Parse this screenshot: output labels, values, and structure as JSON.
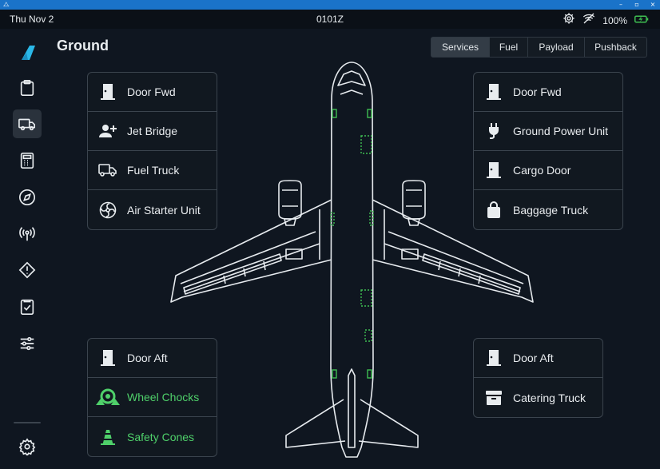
{
  "statusbar": {
    "date": "Thu Nov 2",
    "time": "0101Z",
    "battery": "100%",
    "icons": [
      "gear-icon",
      "no-wifi-icon",
      "battery-charging-icon"
    ]
  },
  "page": {
    "title": "Ground"
  },
  "tabs": [
    {
      "label": "Services",
      "active": true
    },
    {
      "label": "Fuel",
      "active": false
    },
    {
      "label": "Payload",
      "active": false
    },
    {
      "label": "Pushback",
      "active": false
    }
  ],
  "sidebar": {
    "items": [
      "clipboard-icon",
      "truck-icon",
      "calculator-icon",
      "compass-icon",
      "antenna-icon",
      "warning-icon",
      "checklist-icon",
      "sliders-icon",
      "gear-icon"
    ],
    "active": "truck-icon"
  },
  "panels": {
    "left_top": [
      "Door Fwd",
      "Jet Bridge",
      "Fuel Truck",
      "Air Starter Unit"
    ],
    "right_top": [
      "Door Fwd",
      "Ground Power Unit",
      "Cargo Door",
      "Baggage Truck"
    ],
    "left_bottom": [
      "Door Aft",
      "Wheel Chocks",
      "Safety Cones"
    ],
    "right_bottom": [
      "Door Aft",
      "Catering Truck"
    ]
  },
  "colors": {
    "background": "#0f1620",
    "accent": "#2ab8e8",
    "active_green": "#4fd06a",
    "title_bar": "#1a73c9"
  }
}
